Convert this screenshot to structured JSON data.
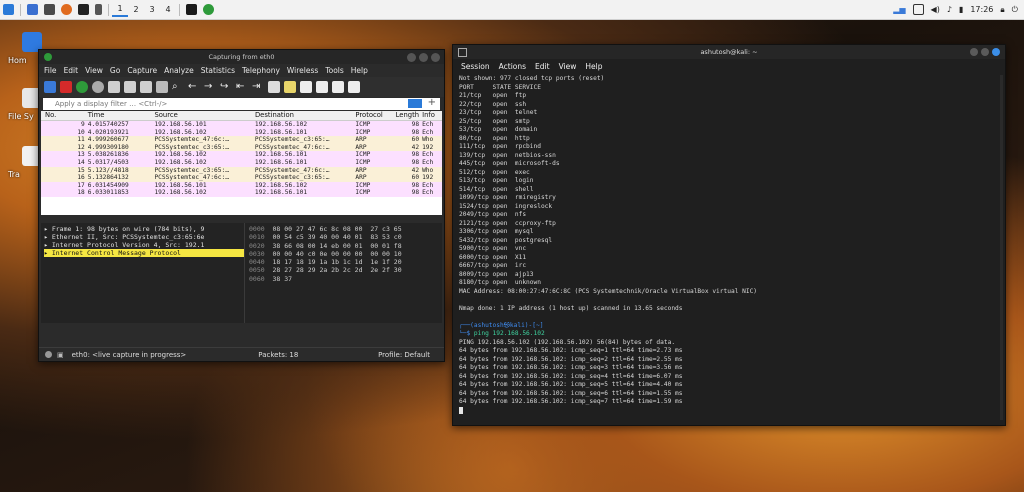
{
  "taskbar": {
    "workspaces": [
      "1",
      "2",
      "3",
      "4"
    ],
    "time": "17:26"
  },
  "desktop": {
    "icons": [
      {
        "label": "Hom",
        "icon": "home-folder-icon"
      },
      {
        "label": "File Sy",
        "icon": "drive-icon"
      },
      {
        "label": "Tra",
        "icon": "trash-icon"
      }
    ]
  },
  "wireshark": {
    "title": "Capturing from eth0",
    "menu": [
      "File",
      "Edit",
      "View",
      "Go",
      "Capture",
      "Analyze",
      "Statistics",
      "Telephony",
      "Wireless",
      "Tools",
      "Help"
    ],
    "filter_placeholder": "Apply a display filter … <Ctrl-/>",
    "columns": [
      "No.",
      "Time",
      "Source",
      "Destination",
      "Protocol",
      "Length",
      "Info"
    ],
    "packets": [
      {
        "no": "9",
        "time": "4.015740257",
        "src": "192.168.56.101",
        "dst": "192.168.56.102",
        "proto": "ICMP",
        "len": "98",
        "info": "Ech",
        "kind": "icmp"
      },
      {
        "no": "10",
        "time": "4.020193921",
        "src": "192.168.56.102",
        "dst": "192.168.56.101",
        "proto": "ICMP",
        "len": "98",
        "info": "Ech",
        "kind": "icmp"
      },
      {
        "no": "11",
        "time": "4.999260677",
        "src": "PCSSystemtec_47:6c:…",
        "dst": "PCSSystemtec_c3:65:…",
        "proto": "ARP",
        "len": "60",
        "info": "Who",
        "kind": "arp"
      },
      {
        "no": "12",
        "time": "4.999309180",
        "src": "PCSSystemtec_c3:65:…",
        "dst": "PCSSystemtec_47:6c:…",
        "proto": "ARP",
        "len": "42",
        "info": "192",
        "kind": "arp"
      },
      {
        "no": "13",
        "time": "5.038261836",
        "src": "192.168.56.102",
        "dst": "192.168.56.101",
        "proto": "ICMP",
        "len": "98",
        "info": "Ech",
        "kind": "icmp"
      },
      {
        "no": "14",
        "time": "5.0317/4503",
        "src": "192.168.56.102",
        "dst": "192.168.56.101",
        "proto": "ICMP",
        "len": "98",
        "info": "Ech",
        "kind": "icmp"
      },
      {
        "no": "15",
        "time": "5.123//4818",
        "src": "PCSSystemtec_c3:65:…",
        "dst": "PCSSystemtec_47:6c:…",
        "proto": "ARP",
        "len": "42",
        "info": "Who",
        "kind": "arp"
      },
      {
        "no": "16",
        "time": "5.132864132",
        "src": "PCSSystemtec_47:6c:…",
        "dst": "PCSSystemtec_c3:65:…",
        "proto": "ARP",
        "len": "60",
        "info": "192",
        "kind": "arp"
      },
      {
        "no": "17",
        "time": "6.031454909",
        "src": "192.168.56.101",
        "dst": "192.168.56.102",
        "proto": "ICMP",
        "len": "98",
        "info": "Ech",
        "kind": "icmp"
      },
      {
        "no": "18",
        "time": "6.033011853",
        "src": "192.168.56.102",
        "dst": "192.168.56.101",
        "proto": "ICMP",
        "len": "98",
        "info": "Ech",
        "kind": "icmp"
      }
    ],
    "details": [
      "▸ Frame 1: 98 bytes on wire (784 bits), 9",
      "▸ Ethernet II, Src: PCSSystemtec_c3:65:6e",
      "▸ Internet Protocol Version 4, Src: 192.1",
      "▸ Internet Control Message Protocol"
    ],
    "hex": [
      {
        "off": "0000",
        "bytes": "08 00 27 47 6c 8c 08 00  27 c3 65"
      },
      {
        "off": "0010",
        "bytes": "00 54 c5 39 40 00 40 01  83 53 c0"
      },
      {
        "off": "0020",
        "bytes": "38 66 08 00 14 eb 00 01  00 01 f8"
      },
      {
        "off": "0030",
        "bytes": "00 00 40 c0 0e 00 00 00  00 00 10"
      },
      {
        "off": "0040",
        "bytes": "18 17 18 19 1a 1b 1c 1d  1e 1f 20"
      },
      {
        "off": "0050",
        "bytes": "28 27 28 29 2a 2b 2c 2d  2e 2f 30"
      },
      {
        "off": "0060",
        "bytes": "38 37"
      }
    ],
    "status_left": "eth0: <live capture in progress>",
    "status_packets": "Packets: 18",
    "status_profile": "Profile: Default"
  },
  "terminal": {
    "title": "ashutosh@kali: ~",
    "menu": [
      "Session",
      "Actions",
      "Edit",
      "View",
      "Help"
    ],
    "lines": [
      "Not shown: 977 closed tcp ports (reset)",
      "PORT     STATE SERVICE",
      "21/tcp   open  ftp",
      "22/tcp   open  ssh",
      "23/tcp   open  telnet",
      "25/tcp   open  smtp",
      "53/tcp   open  domain",
      "80/tcp   open  http",
      "111/tcp  open  rpcbind",
      "139/tcp  open  netbios-ssn",
      "445/tcp  open  microsoft-ds",
      "512/tcp  open  exec",
      "513/tcp  open  login",
      "514/tcp  open  shell",
      "1099/tcp open  rmiregistry",
      "1524/tcp open  ingreslock",
      "2049/tcp open  nfs",
      "2121/tcp open  ccproxy-ftp",
      "3306/tcp open  mysql",
      "5432/tcp open  postgresql",
      "5900/tcp open  vnc",
      "6000/tcp open  X11",
      "6667/tcp open  irc",
      "8009/tcp open  ajp13",
      "8180/tcp open  unknown",
      "MAC Address: 08:00:27:47:6C:8C (PCS Systemtechnik/Oracle VirtualBox virtual NIC)",
      "",
      "Nmap done: 1 IP address (1 host up) scanned in 13.65 seconds",
      ""
    ],
    "prompt_line1": "┌──(ashutosh㉿kali)-[~]",
    "prompt_line2": "└─$ ",
    "command": "ping 192.168.56.102",
    "ping_lines": [
      "PING 192.168.56.102 (192.168.56.102) 56(84) bytes of data.",
      "64 bytes from 192.168.56.102: icmp_seq=1 ttl=64 time=2.73 ms",
      "64 bytes from 192.168.56.102: icmp_seq=2 ttl=64 time=2.55 ms",
      "64 bytes from 192.168.56.102: icmp_seq=3 ttl=64 time=3.56 ms",
      "64 bytes from 192.168.56.102: icmp_seq=4 ttl=64 time=6.07 ms",
      "64 bytes from 192.168.56.102: icmp_seq=5 ttl=64 time=4.40 ms",
      "64 bytes from 192.168.56.102: icmp_seq=6 ttl=64 time=1.55 ms",
      "64 bytes from 192.168.56.102: icmp_seq=7 ttl=64 time=1.59 ms"
    ]
  }
}
